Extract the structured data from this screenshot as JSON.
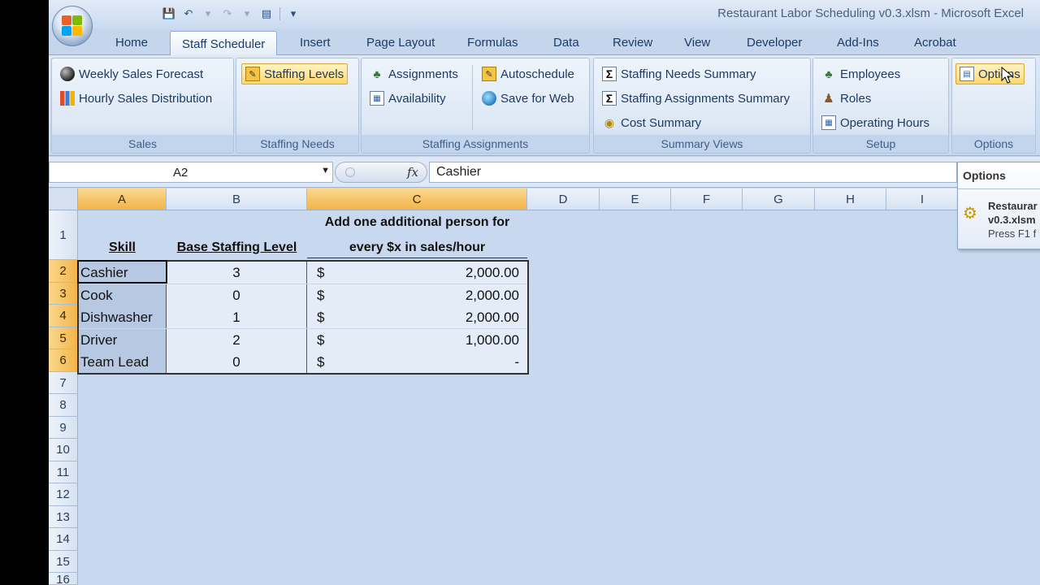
{
  "window": {
    "title": "Restaurant Labor Scheduling v0.3.xlsm - Microsoft Excel"
  },
  "quick_access": {
    "icons": [
      "save-icon",
      "undo-icon",
      "redo-icon",
      "form-icon",
      "customize-icon"
    ]
  },
  "tabs": [
    {
      "label": "Home"
    },
    {
      "label": "Staff Scheduler",
      "active": true
    },
    {
      "label": "Insert"
    },
    {
      "label": "Page Layout"
    },
    {
      "label": "Formulas"
    },
    {
      "label": "Data"
    },
    {
      "label": "Review"
    },
    {
      "label": "View"
    },
    {
      "label": "Developer"
    },
    {
      "label": "Add-Ins"
    },
    {
      "label": "Acrobat"
    }
  ],
  "ribbon": {
    "sales": {
      "label": "Sales",
      "weekly": "Weekly Sales Forecast",
      "hourly": "Hourly Sales Distribution"
    },
    "staffing_needs": {
      "label": "Staffing Needs",
      "levels": "Staffing Levels"
    },
    "staffing_assignments": {
      "label": "Staffing Assignments",
      "assignments": "Assignments",
      "availability": "Availability",
      "autoschedule": "Autoschedule",
      "save_web": "Save for Web"
    },
    "summary_views": {
      "label": "Summary Views",
      "needs": "Staffing Needs Summary",
      "assign": "Staffing Assignments Summary",
      "cost": "Cost Summary"
    },
    "setup": {
      "label": "Setup",
      "employees": "Employees",
      "roles": "Roles",
      "hours": "Operating Hours"
    },
    "options": {
      "label": "Options",
      "button": "Options"
    }
  },
  "formula_bar": {
    "name_box": "A2",
    "fx": "fx",
    "value": "Cashier"
  },
  "columns": [
    "A",
    "B",
    "C",
    "D",
    "E",
    "F",
    "G",
    "H",
    "I"
  ],
  "rows": [
    "1",
    "2",
    "3",
    "4",
    "5",
    "6",
    "7",
    "8",
    "9",
    "10",
    "11",
    "12",
    "13",
    "14",
    "15",
    "16"
  ],
  "sheet": {
    "header": {
      "skill": "Skill",
      "base": "Base Staffing Level",
      "add_line1": "Add one additional person for",
      "add_line2": "every $x in sales/hour"
    },
    "table": [
      {
        "skill": "Cashier",
        "base": "3",
        "cur": "$",
        "amount": "2,000.00"
      },
      {
        "skill": "Cook",
        "base": "0",
        "cur": "$",
        "amount": "2,000.00"
      },
      {
        "skill": "Dishwasher",
        "base": "1",
        "cur": "$",
        "amount": "2,000.00"
      },
      {
        "skill": "Driver",
        "base": "2",
        "cur": "$",
        "amount": "1,000.00"
      },
      {
        "skill": "Team Lead",
        "base": "0",
        "cur": "$",
        "amount": "-"
      }
    ]
  },
  "tooltip": {
    "title": "Options",
    "name_line1": "Restaurar",
    "name_line2": "v0.3.xlsm",
    "hint": "Press F1 f"
  }
}
